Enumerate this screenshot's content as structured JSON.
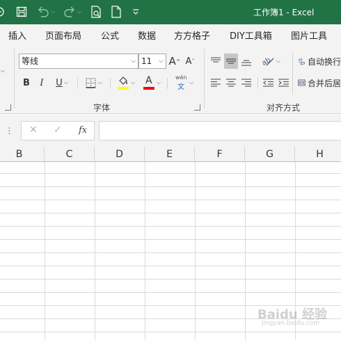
{
  "window": {
    "title": "工作簿1 - Excel",
    "accent_color": "#217346"
  },
  "quick_access": {
    "icons": [
      "app-menu-icon",
      "save-icon",
      "undo-icon",
      "redo-icon",
      "print-preview-icon",
      "new-file-icon",
      "customize-qat-icon"
    ]
  },
  "tabs": [
    "插入",
    "页面布局",
    "公式",
    "数据",
    "方方格子",
    "DIY工具箱",
    "图片工具"
  ],
  "font_group": {
    "font_name": "等线",
    "font_size": "11",
    "grow_label": "A",
    "shrink_label": "A",
    "bold": "B",
    "italic": "I",
    "underline": "U",
    "font_color_letter": "A",
    "phonetic_top": "wén",
    "phonetic_bottom": "文",
    "group_label": "字体",
    "fill_color": "#ffff00",
    "font_color": "#ff0000"
  },
  "align_group": {
    "wrap_text": "自动换行",
    "merge_center": "合并后居",
    "group_label": "对齐方式"
  },
  "formula_bar": {
    "cancel": "✕",
    "enter": "✓",
    "fx": "fx"
  },
  "columns": [
    "B",
    "C",
    "D",
    "E",
    "F",
    "G",
    "H"
  ],
  "watermark": {
    "text": "Baidu 经验",
    "sub": "jingyan.baidu.com"
  }
}
